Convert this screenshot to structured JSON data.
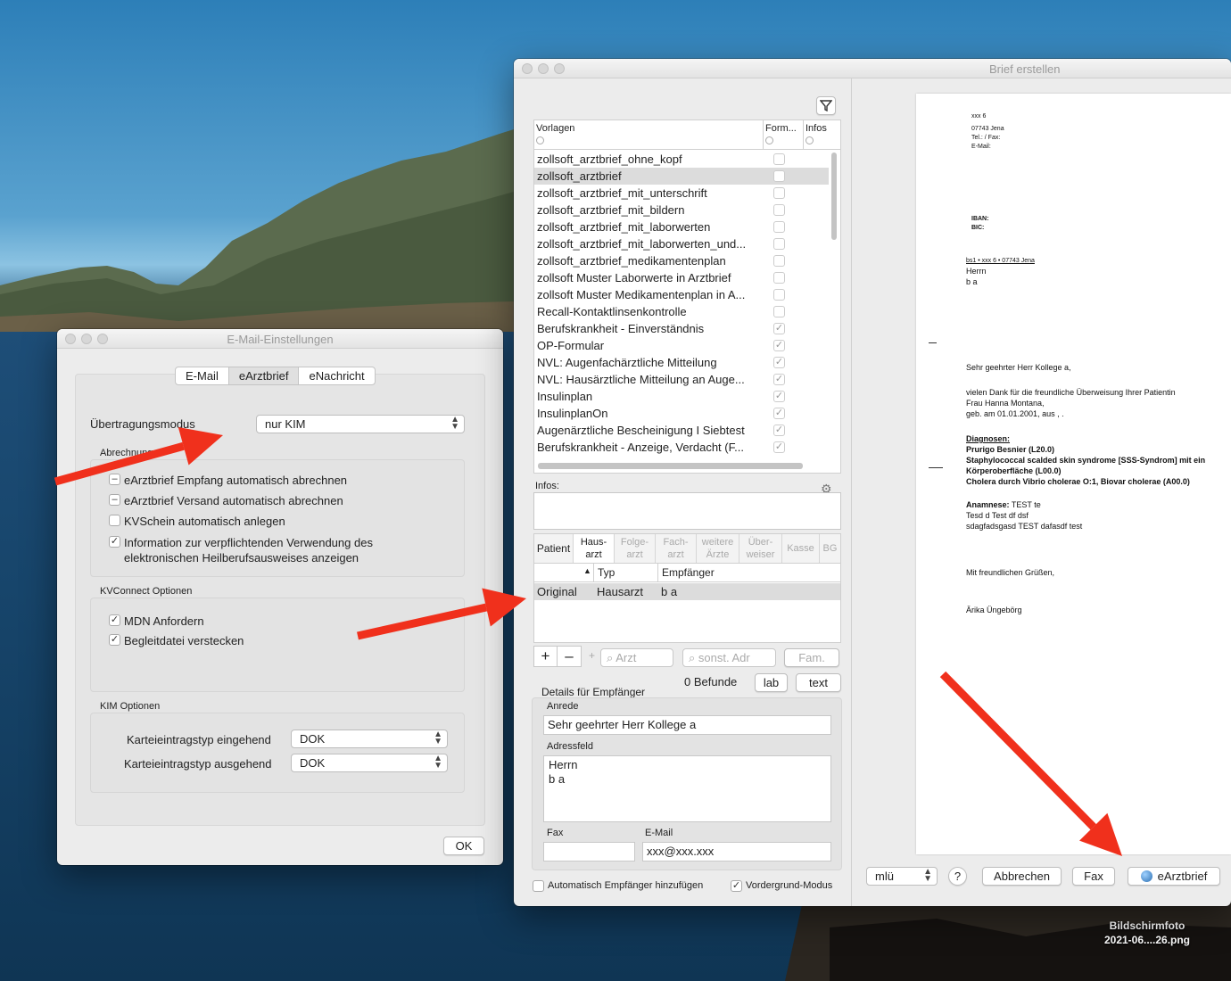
{
  "desktop": {
    "screenshot_label_1": "Bildschirmfoto",
    "screenshot_label_2": "2021-06....26.png"
  },
  "email_settings": {
    "title": "E-Mail-Einstellungen",
    "tabs": [
      "E-Mail",
      "eArztbrief",
      "eNachricht"
    ],
    "mode_label": "Übertragungsmodus",
    "mode_value": "nur KIM",
    "billing_label": "Abrechnung",
    "billing_options": [
      "eArztbrief Empfang automatisch abrechnen",
      "eArztbrief Versand automatisch abrechnen",
      "KVSchein automatisch anlegen",
      "Information zur verpflichtenden Verwendung des",
      "elektronischen Heilberufsausweises anzeigen"
    ],
    "kvconnect_label": "KVConnect Optionen",
    "kvconnect_options": [
      "MDN Anfordern",
      "Begleitdatei verstecken"
    ],
    "kim_label": "KIM Optionen",
    "kim_in_label": "Karteieintragstyp eingehend",
    "kim_in_value": "DOK",
    "kim_out_label": "Karteieintragstyp ausgehend",
    "kim_out_value": "DOK",
    "ok": "OK"
  },
  "brief": {
    "title": "Brief erstellen",
    "columns": {
      "vorlagen": "Vorlagen",
      "form": "Form...",
      "infos": "Infos"
    },
    "templates": [
      "zollsoft_arztbrief_ohne_kopf",
      "zollsoft_arztbrief",
      "zollsoft_arztbrief_mit_unterschrift",
      "zollsoft_arztbrief_mit_bildern",
      "zollsoft_arztbrief_mit_laborwerten",
      "zollsoft_arztbrief_mit_laborwerten_und...",
      "zollsoft_arztbrief_medikamentenplan",
      "zollsoft Muster Laborwerte in Arztbrief",
      "zollsoft Muster Medikamentenplan in A...",
      "Recall-Kontaktlinsenkontrolle",
      "Berufskrankheit - Einverständnis",
      "OP-Formular",
      "NVL: Augenfachärztliche Mitteilung",
      "NVL: Hausärztliche Mitteilung an Auge...",
      "Insulinplan",
      "InsulinplanOn",
      "Augenärztliche Bescheinigung I Siebtest",
      "Berufskrankheit - Anzeige, Verdacht (F..."
    ],
    "infos_label": "Infos:",
    "recipient_tabs": [
      "Patient",
      "Haus-",
      "arzt",
      "Folge-",
      "arzt",
      "Fach-",
      "arzt",
      "weitere",
      "Ärzte",
      "Über-",
      "weiser",
      "Kasse",
      "BG"
    ],
    "recipient_cols": {
      "typ": "Typ",
      "empf": "Empfänger"
    },
    "recipient_row": {
      "kind": "Original",
      "typ": "Hausarzt",
      "empf": "b a"
    },
    "search_arzt": "Arzt",
    "search_sonst": "sonst. Adr",
    "fam": "Fam.",
    "befunde": "0 Befunde",
    "lab": "lab",
    "text": "text",
    "details_label": "Details für Empfänger",
    "anrede_label": "Anrede",
    "anrede_value": "Sehr geehrter Herr Kollege a",
    "adress_label": "Adressfeld",
    "adress_lines": [
      "Herrn",
      "b a"
    ],
    "fax_label": "Fax",
    "email_label": "E-Mail",
    "email_value": "xxx@xxx.xxx",
    "auto_label": "Automatisch Empfänger hinzufügen",
    "vorder_label": "Vordergrund-Modus",
    "user_select": "mlü",
    "help": "?",
    "cancel": "Abbrechen",
    "fax_btn": "Fax",
    "earzt_btn": "eArztbrief"
  },
  "letter": {
    "sender": [
      "xxx 6",
      "07743 Jena",
      "Tel.:  / Fax:",
      "E-Mail:"
    ],
    "bank": [
      "IBAN:",
      "BIC:"
    ],
    "return_line": "bs1 • xxx 6 • 07743 Jena",
    "address": [
      "Herrn",
      "b a"
    ],
    "salutation": "Sehr geehrter Herr Kollege a,",
    "intro": [
      "vielen Dank für die freundliche Überweisung Ihrer Patientin",
      "Frau Hanna Montana,",
      "geb. am 01.01.2001, aus  , ."
    ],
    "diag_title": "Diagnosen:",
    "diagnoses": [
      "Prurigo Besnier (L20.0)",
      "Staphylococcal scalded skin syndrome [SSS-Syndrom] mit ein",
      "Körperoberfläche (L00.0)",
      "Cholera durch Vibrio cholerae O:1, Biovar cholerae (A00.0)"
    ],
    "anam_title": "Anamnese:",
    "anam_first": "TEST te",
    "anam_lines": [
      "Tesd d Test df dsf",
      "sdagfadsgasd TEST dafasdf test"
    ],
    "closing": "Mit freundlichen Grüßen,",
    "signature": "Ärika Üngebörg"
  },
  "colors": {
    "arrow": "#f0301c",
    "selection": "#dcdcdc"
  }
}
